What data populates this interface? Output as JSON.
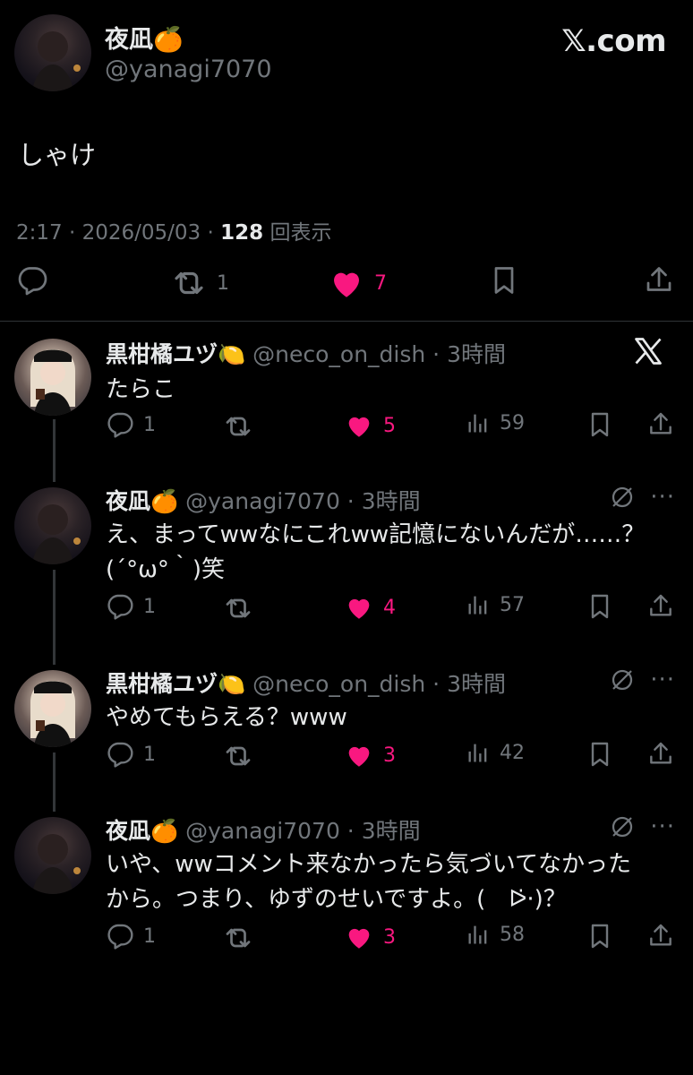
{
  "main": {
    "author": "夜凪🍊",
    "handle": "@yanagi7070",
    "brand": "𝕏.com",
    "text": "しゃけ",
    "time": "2:17",
    "date": "2026/05/03",
    "views_count": "128",
    "views_label": "回表示",
    "retweets": "1",
    "likes": "7"
  },
  "replies": [
    {
      "author": "黒柑橘ユヅ🍋",
      "handle": "@neco_on_dish",
      "time": "3時間",
      "text": "たらこ",
      "replies": "1",
      "likes": "5",
      "views": "59"
    },
    {
      "author": "夜凪🍊",
      "handle": "@yanagi7070",
      "time": "3時間",
      "text_line1": "え、まってwwなにこれww記憶にないんだが……？",
      "text_line2": "(´°ω°｀)笑",
      "replies": "1",
      "likes": "4",
      "views": "57"
    },
    {
      "author": "黒柑橘ユヅ🍋",
      "handle": "@neco_on_dish",
      "time": "3時間",
      "text": "やめてもらえる？www",
      "replies": "1",
      "likes": "3",
      "views": "42"
    },
    {
      "author": "夜凪🍊",
      "handle": "@yanagi7070",
      "time": "3時間",
      "text_line1": "いや、wwコメント来なかったら気づいてなかった",
      "text_line2": "から。つまり、ゆずのせいですよ。(　ᐅ̇·)？",
      "replies": "1",
      "likes": "3",
      "views": "58"
    }
  ],
  "colors": {
    "background": "#000000",
    "text": "#e7e9ea",
    "muted": "#71767b",
    "like": "#f91880",
    "divider": "#2f3336"
  },
  "icons": [
    "reply-icon",
    "retweet-icon",
    "heart-icon",
    "bookmark-icon",
    "share-icon",
    "views-icon",
    "x-logo-icon",
    "grok-icon",
    "more-icon"
  ]
}
